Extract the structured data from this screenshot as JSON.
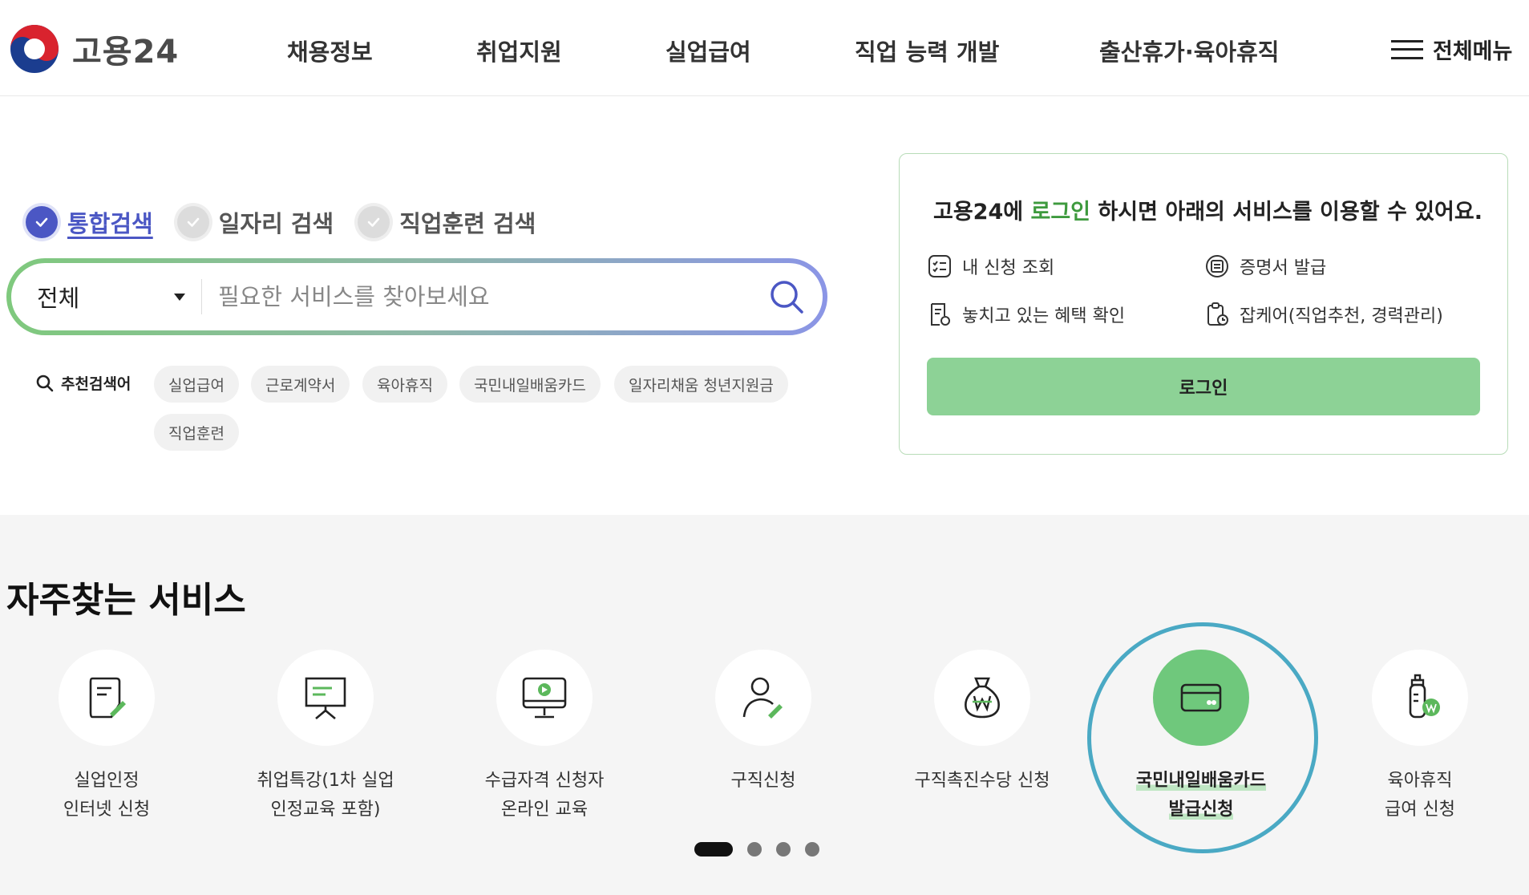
{
  "header": {
    "logo_text": "고용24",
    "nav": [
      "채용정보",
      "취업지원",
      "실업급여",
      "직업 능력 개발",
      "출산휴가·육아휴직"
    ],
    "all_menu": "전체메뉴"
  },
  "search": {
    "tabs": [
      {
        "label": "통합검색",
        "active": true
      },
      {
        "label": "일자리 검색",
        "active": false
      },
      {
        "label": "직업훈련 검색",
        "active": false
      }
    ],
    "select_value": "전체",
    "placeholder": "필요한 서비스를 찾아보세요",
    "recommended_label": "추천검색어",
    "keywords": [
      "실업급여",
      "근로계약서",
      "육아휴직",
      "국민내일배움카드",
      "일자리채움 청년지원금",
      "직업훈련"
    ]
  },
  "login": {
    "title_pre": "고용24에 ",
    "title_highlight": "로그인",
    "title_post": " 하시면 아래의 서비스를 이용할 수 있어요.",
    "services": [
      "내 신청 조회",
      "증명서 발급",
      "놓치고 있는 혜택 확인",
      "잡케어(직업추천, 경력관리)"
    ],
    "button": "로그인"
  },
  "frequent": {
    "title": "자주찾는 서비스",
    "items": [
      {
        "line1": "실업인정",
        "line2": "인터넷 신청",
        "icon": "document-pen-icon"
      },
      {
        "line1": "취업특강(1차 실업",
        "line2": "인정교육 포함)",
        "icon": "presentation-board-icon"
      },
      {
        "line1": "수급자격 신청자",
        "line2": "온라인 교육",
        "icon": "monitor-play-icon"
      },
      {
        "line1": "구직신청",
        "line2": "",
        "icon": "person-pen-icon"
      },
      {
        "line1": "구직촉진수당 신청",
        "line2": "",
        "icon": "money-bag-won-icon"
      },
      {
        "line1": "국민내일배움카드",
        "line2": "발급신청",
        "icon": "card-icon"
      },
      {
        "line1": "육아휴직",
        "line2": "급여 신청",
        "icon": "baby-bottle-won-icon"
      }
    ]
  },
  "colors": {
    "accent_blue": "#4b57c4",
    "accent_green": "#3d9a3d",
    "login_button": "#8dd296",
    "highlight_ring": "#4aa9c4"
  }
}
